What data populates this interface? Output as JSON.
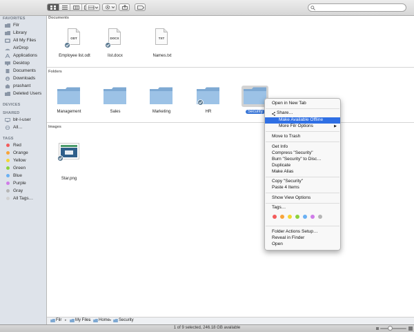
{
  "colors": {
    "tag_red": "#f35c5c",
    "tag_orange": "#f8a43a",
    "tag_yellow": "#f3d532",
    "tag_green": "#8cd23c",
    "tag_blue": "#6ab0f3",
    "tag_purple": "#cf7ce8",
    "tag_gray": "#b5b5b5",
    "highlight": "#2f6fe4",
    "folder_blue": "#8eb6dc"
  },
  "search": {
    "placeholder": ""
  },
  "sidebar": {
    "favorites_header": "FAVORITES",
    "favorites": [
      {
        "label": "Filr",
        "icon": "folder-icon"
      },
      {
        "label": "Library",
        "icon": "folder-icon"
      },
      {
        "label": "All My Files",
        "icon": "all-files-icon"
      },
      {
        "label": "AirDrop",
        "icon": "airdrop-icon"
      },
      {
        "label": "Applications",
        "icon": "applications-icon"
      },
      {
        "label": "Desktop",
        "icon": "desktop-icon"
      },
      {
        "label": "Documents",
        "icon": "documents-icon"
      },
      {
        "label": "Downloads",
        "icon": "downloads-icon"
      },
      {
        "label": "prashant",
        "icon": "home-icon"
      },
      {
        "label": "Deleted Users",
        "icon": "folder-icon"
      }
    ],
    "devices_header": "DEVICES",
    "shared_header": "SHARED",
    "shared": [
      {
        "label": "blr-l-user",
        "icon": "computer-icon"
      },
      {
        "label": "All…",
        "icon": "network-icon"
      }
    ],
    "tags_header": "TAGS",
    "tags": [
      {
        "label": "Red",
        "color": "#f35c5c"
      },
      {
        "label": "Orange",
        "color": "#f8a43a"
      },
      {
        "label": "Yellow",
        "color": "#f3d532"
      },
      {
        "label": "Green",
        "color": "#8cd23c"
      },
      {
        "label": "Blue",
        "color": "#6ab0f3"
      },
      {
        "label": "Purple",
        "color": "#cf7ce8"
      },
      {
        "label": "Gray",
        "color": "#b5b5b5"
      },
      {
        "label": "All Tags…",
        "color": "#d0d0d0"
      }
    ]
  },
  "main": {
    "documents_header": "Documents",
    "documents": [
      {
        "label": "Employee list.odt",
        "ext": "ODT",
        "synced": true
      },
      {
        "label": "list.docx",
        "ext": "DOCX",
        "synced": true
      },
      {
        "label": "Names.txt",
        "ext": "TXT",
        "synced": false
      }
    ],
    "folders_header": "Folders",
    "folders": [
      {
        "label": "Management",
        "synced": false
      },
      {
        "label": "Sales",
        "synced": false
      },
      {
        "label": "Marketing",
        "synced": false
      },
      {
        "label": "HR",
        "synced": true
      },
      {
        "label": "Security",
        "synced": false,
        "selected": true
      }
    ],
    "images_header": "Images",
    "images": [
      {
        "label": "Star.png",
        "synced": true
      }
    ]
  },
  "pathbar": {
    "items": [
      "Filr",
      "My Files",
      "Home",
      "Security"
    ],
    "separator": "▸"
  },
  "status": {
    "text": "1 of 9 selected, 246.18 GB available"
  },
  "context_menu": {
    "open_new_tab": "Open in New Tab",
    "share": "Share…",
    "make_offline": "Make Available Offline",
    "more_filr": "More Filr Options",
    "move_trash": "Move to Trash",
    "get_info": "Get Info",
    "compress": "Compress \"Security\"",
    "burn": "Burn \"Security\" to Disc…",
    "duplicate": "Duplicate",
    "make_alias": "Make Alias",
    "copy": "Copy \"Security\"",
    "paste": "Paste 4 Items",
    "view_options": "Show View Options",
    "tags": "Tags…",
    "tag_colors": [
      "#f35c5c",
      "#f8a43a",
      "#f3d532",
      "#8cd23c",
      "#6ab0f3",
      "#cf7ce8",
      "#b5b5b5"
    ],
    "folder_actions": "Folder Actions Setup…",
    "reveal": "Reveal in Finder",
    "open": "Open"
  }
}
